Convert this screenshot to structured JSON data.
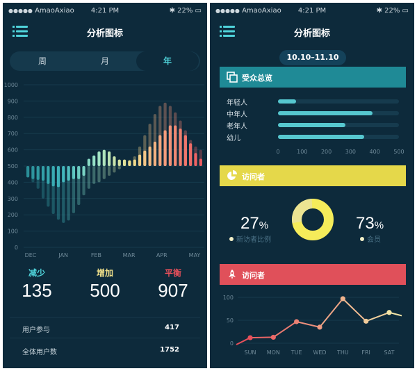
{
  "colors": {
    "bg": "#0d2a3b",
    "teal": "#4fd3da",
    "yellow": "#e7d94d",
    "red": "#e8505b",
    "cardTeal": "#1f8a96",
    "cardYellow": "#e5d84a",
    "cardRed": "#e0505a"
  },
  "statusbar": {
    "carrier": "AmaoAxiao",
    "time": "4:21 PM",
    "battery": "22%"
  },
  "left": {
    "title": "分析图标",
    "tabs": [
      "周",
      "月",
      "年"
    ],
    "selected_tab": "年",
    "stats": [
      {
        "label": "减少",
        "value": "135",
        "color": "#4fd3da"
      },
      {
        "label": "增加",
        "value": "500",
        "color": "#f0e08a"
      },
      {
        "label": "平衡",
        "value": "907",
        "color": "#e8505b"
      }
    ],
    "rows": [
      {
        "label": "用户参与",
        "value": "417"
      },
      {
        "label": "全体用户数",
        "value": "1752"
      }
    ]
  },
  "right": {
    "title": "分析图标",
    "date_range": "10.10–11.10",
    "audience": {
      "title": "受众总览",
      "icon": "copy-icon"
    },
    "visitors": {
      "title": "访问者",
      "icon": "pie-chart-icon",
      "left_pct": "27",
      "left_label": "新访者比例",
      "right_pct": "73",
      "right_label": "会员",
      "pct_suffix": "%"
    },
    "visitors2": {
      "title": "访问者",
      "icon": "rocket-icon"
    }
  },
  "chart_data": [
    {
      "type": "bar",
      "title": "",
      "ylim": [
        0,
        1000
      ],
      "y_ticks": [
        0,
        100,
        200,
        300,
        400,
        500,
        600,
        700,
        800,
        900,
        1000
      ],
      "x_ticks": [
        "DEC",
        "JAN",
        "FEB",
        "MAR",
        "APR",
        "MAY"
      ],
      "baseline": 500,
      "series": [
        {
          "values": [
            430,
            420,
            415,
            410,
            390,
            375,
            370,
            400,
            410,
            420,
            420,
            440,
            545,
            565,
            590,
            600,
            590,
            560,
            540,
            540,
            535,
            540,
            570,
            595,
            620,
            650,
            690,
            720,
            750,
            750,
            730,
            690,
            640,
            580,
            545
          ]
        },
        {
          "values": [
            430,
            400,
            360,
            300,
            250,
            205,
            170,
            150,
            165,
            210,
            260,
            320,
            360,
            390,
            400,
            420,
            440,
            460,
            480,
            510,
            530,
            560,
            620,
            690,
            760,
            820,
            870,
            890,
            870,
            830,
            780,
            720,
            660,
            620,
            600
          ]
        }
      ]
    },
    {
      "type": "bar",
      "title": "受众总览",
      "orientation": "horizontal",
      "categories": [
        "年轻人",
        "中年人",
        "老年人",
        "幼儿"
      ],
      "values": [
        75,
        390,
        280,
        355
      ],
      "xlim": [
        0,
        500
      ],
      "x_ticks": [
        0,
        100,
        200,
        300,
        400,
        500
      ]
    },
    {
      "type": "pie",
      "title": "访问者",
      "labels": [
        "新访者比例",
        "会员"
      ],
      "values": [
        27,
        73
      ]
    },
    {
      "type": "line",
      "title": "访问者",
      "categories": [
        "SUN",
        "MON",
        "TUE",
        "WED",
        "THU",
        "FRI",
        "SAT"
      ],
      "values": [
        12,
        13,
        47,
        35,
        97,
        48,
        67
      ],
      "ylim": [
        0,
        100
      ],
      "y_ticks": [
        0,
        50,
        100
      ]
    }
  ]
}
